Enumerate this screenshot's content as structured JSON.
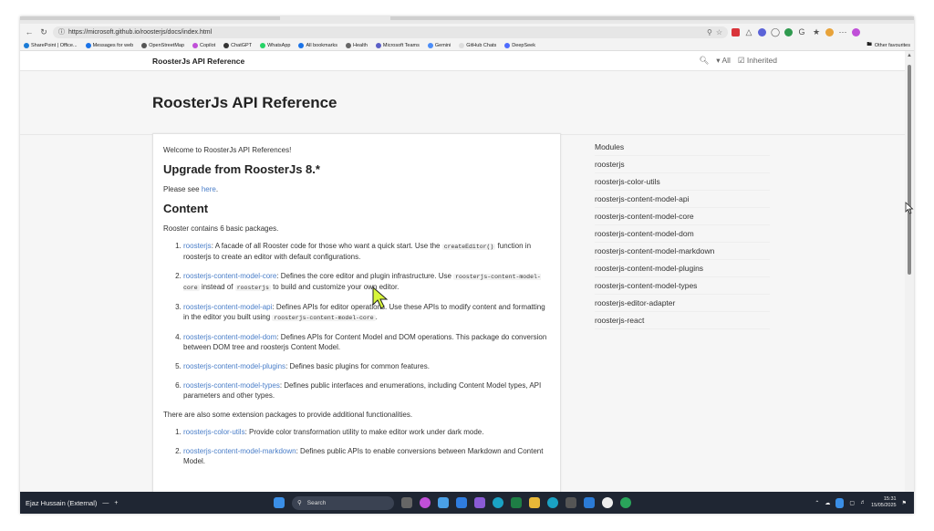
{
  "browser": {
    "url_host": "https://microsoft.github.io",
    "url_path": "/roosterjs/docs/index.html",
    "bookmarks": [
      {
        "label": "SharePoint | Office...",
        "color": "#1a7bd6"
      },
      {
        "label": "Messages for web",
        "color": "#1a73e8"
      },
      {
        "label": "OpenStreetMap",
        "color": "#555555"
      },
      {
        "label": "Copilot",
        "color": "#c04fd8"
      },
      {
        "label": "ChatGPT",
        "color": "#333333"
      },
      {
        "label": "WhatsApp",
        "color": "#25d366"
      },
      {
        "label": "All bookmarks",
        "color": "#1a73e8"
      },
      {
        "label": "Health",
        "color": "#666666"
      },
      {
        "label": "Microsoft Teams",
        "color": "#5b5fc7"
      },
      {
        "label": "Gemini",
        "color": "#4b8df8"
      },
      {
        "label": "GitHub Chats",
        "color": "#dddddd"
      },
      {
        "label": "DeepSeek",
        "color": "#4d6bfe"
      }
    ],
    "other_favourites": "Other favourites"
  },
  "site": {
    "header_title": "RoosterJs API Reference",
    "filter_all": "All",
    "filter_inherited": "Inherited",
    "page_title": "RoosterJs API Reference"
  },
  "content": {
    "welcome": "Welcome to RoosterJs API References!",
    "upgrade_heading": "Upgrade from RoosterJs 8.*",
    "please_see_prefix": "Please see ",
    "please_see_link": "here",
    "please_see_suffix": ".",
    "content_heading": "Content",
    "intro": "Rooster contains 6 basic packages.",
    "packages": [
      {
        "link": "roosterjs",
        "pre": ": A facade of all Rooster code for those who want a quick start. Use the ",
        "code": "createEditor()",
        "post": " function in roosterjs to create an editor with default configurations."
      },
      {
        "link": "roosterjs-content-model-core",
        "pre": ": Defines the core editor and plugin infrastructure. Use ",
        "code": "roosterjs-content-model-core",
        "mid": " instead of ",
        "code2": "roosterjs",
        "post": " to build and customize your own editor."
      },
      {
        "link": "roosterjs-content-model-api",
        "pre": ": Defines APIs for editor operations. Use these APIs to modify content and formatting in the editor you built using ",
        "code": "roosterjs-content-model-core",
        "post": "."
      },
      {
        "link": "roosterjs-content-model-dom",
        "pre": ": Defines APIs for Content Model and DOM operations. This package do conversion between DOM tree and roosterjs Content Model."
      },
      {
        "link": "roosterjs-content-model-plugins",
        "pre": ": Defines basic plugins for common features."
      },
      {
        "link": "roosterjs-content-model-types",
        "pre": ": Defines public interfaces and enumerations, including Content Model types, API parameters and other types."
      }
    ],
    "extension_intro": "There are also some extension packages to provide additional functionalities.",
    "extensions": [
      {
        "link": "roosterjs-color-utils",
        "pre": ": Provide color transformation utility to make editor work under dark mode."
      },
      {
        "link": "roosterjs-content-model-markdown",
        "pre": ": Defines public APIs to enable conversions between Markdown and Content Model."
      }
    ]
  },
  "sidebar": {
    "items": [
      "Modules",
      "roosterjs",
      "roosterjs-color-utils",
      "roosterjs-content-model-api",
      "roosterjs-content-model-core",
      "roosterjs-content-model-dom",
      "roosterjs-content-model-markdown",
      "roosterjs-content-model-plugins",
      "roosterjs-content-model-types",
      "roosterjs-editor-adapter",
      "roosterjs-react"
    ]
  },
  "taskbar": {
    "user_label": "Ejaz Hussain (External)",
    "search_placeholder": "Search",
    "time": "15:31",
    "date": "15/05/2025"
  },
  "colors": {
    "link": "#4a7ec8",
    "taskbar": "#1f2633"
  }
}
